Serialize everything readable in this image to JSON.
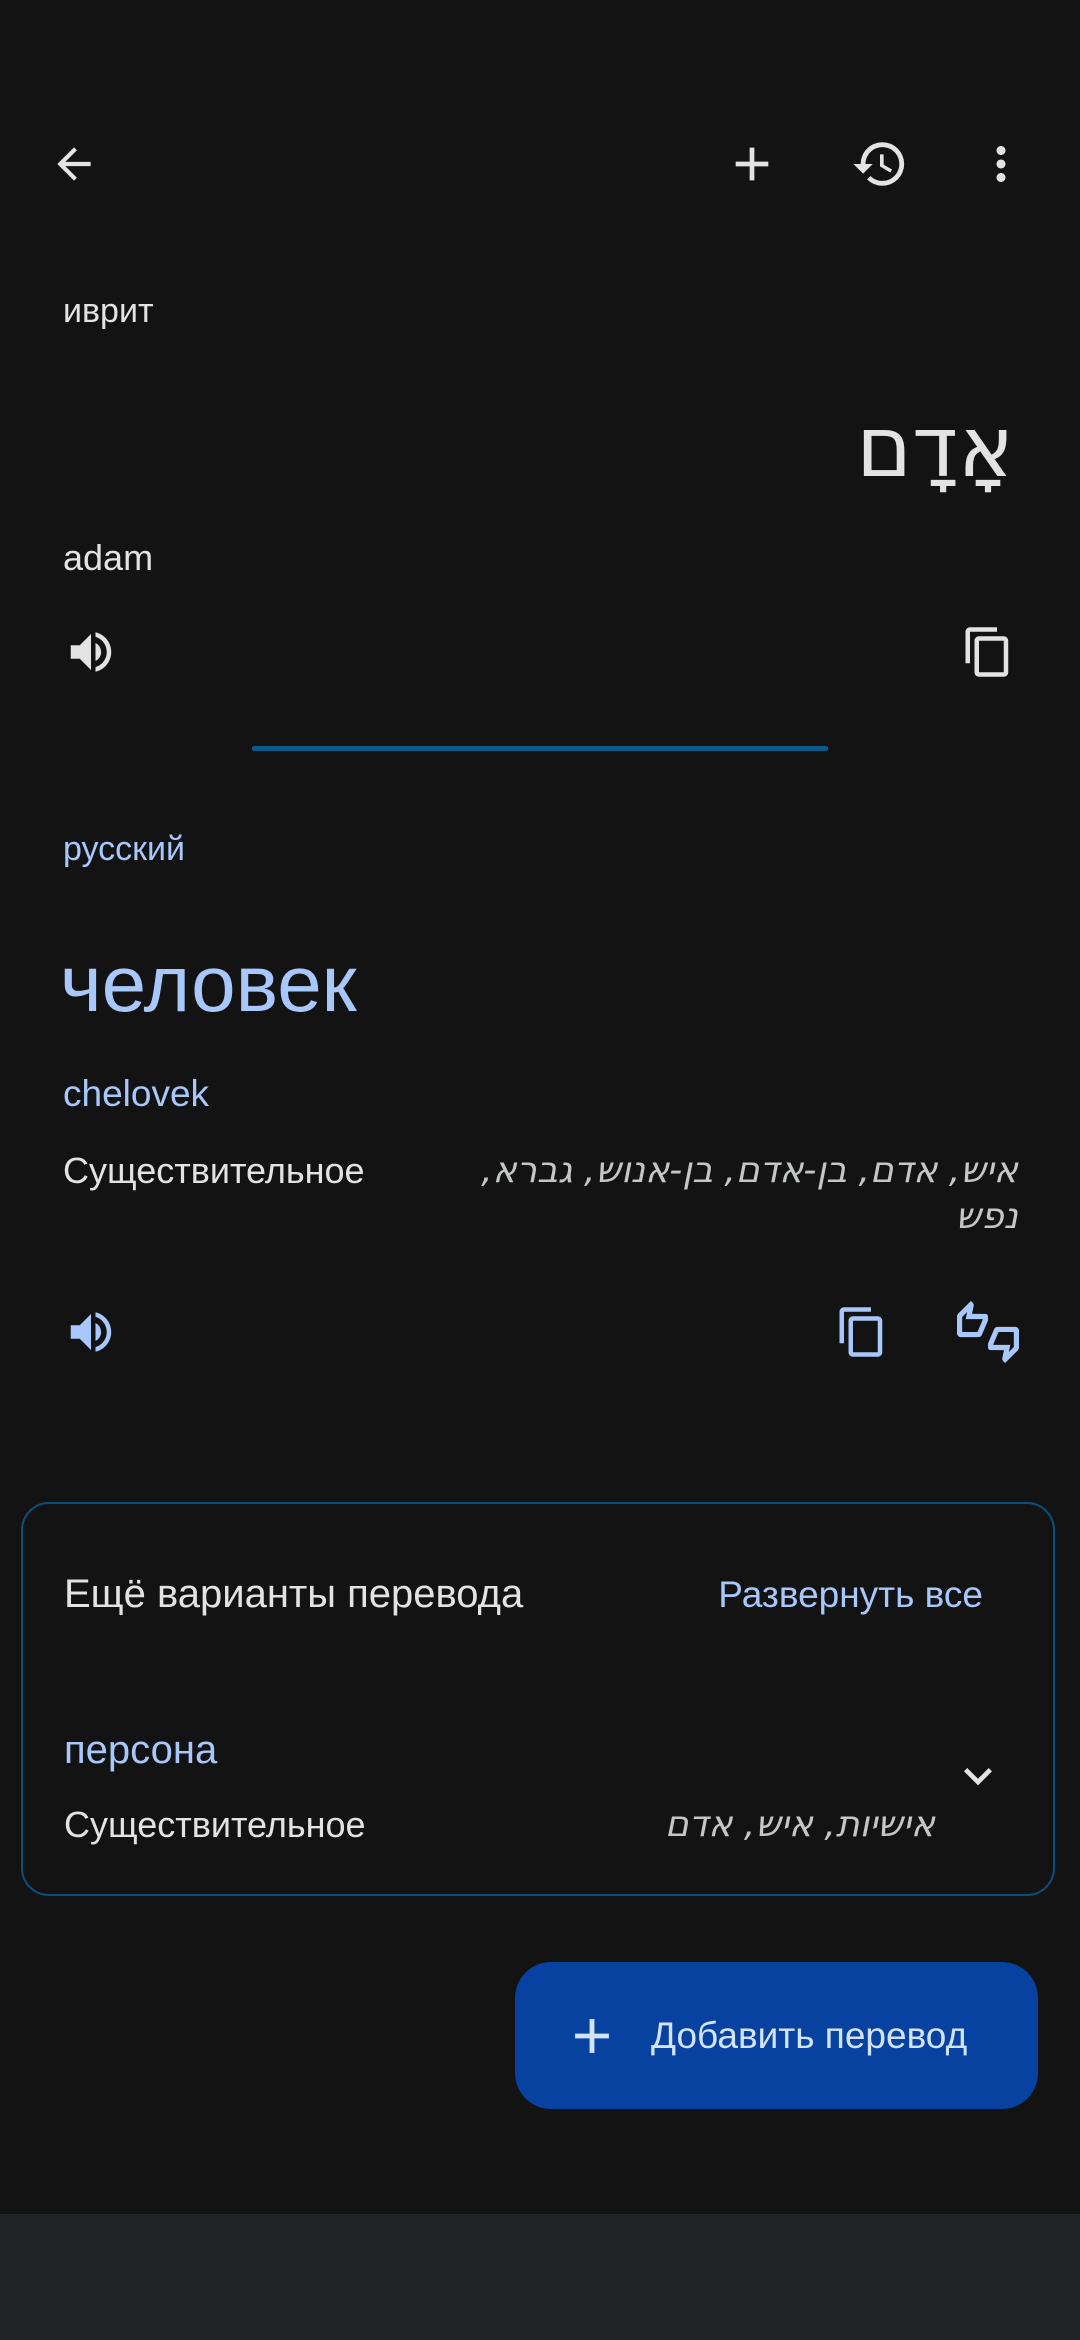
{
  "source": {
    "language": "иврит",
    "text": "אָדָם",
    "transliteration": "adam"
  },
  "target": {
    "language": "русский",
    "text": "человек",
    "transliteration": "chelovek",
    "part_of_speech": "Существительное",
    "synonyms": "איש, אדם, בן-אדם, בן-אנוש, גברא, נפש"
  },
  "more_translations": {
    "title": "Ещё варианты перевода",
    "expand_all": "Развернуть все",
    "items": [
      {
        "word": "персона",
        "part_of_speech": "Существительное",
        "synonyms": "אישיות, איש, אדם"
      }
    ]
  },
  "fab": {
    "label": "Добавить перевод"
  },
  "icons": {
    "back": "arrow-back-icon",
    "add": "plus-icon",
    "history": "history-icon",
    "more": "more-vert-icon",
    "speak": "volume-icon",
    "copy": "copy-icon",
    "feedback": "thumbs-up-down-icon",
    "expand": "chevron-down-icon"
  },
  "colors": {
    "background": "#131314",
    "accent": "#a8c7fa",
    "fab": "#0842a0",
    "card_border": "#0b4f7d"
  }
}
